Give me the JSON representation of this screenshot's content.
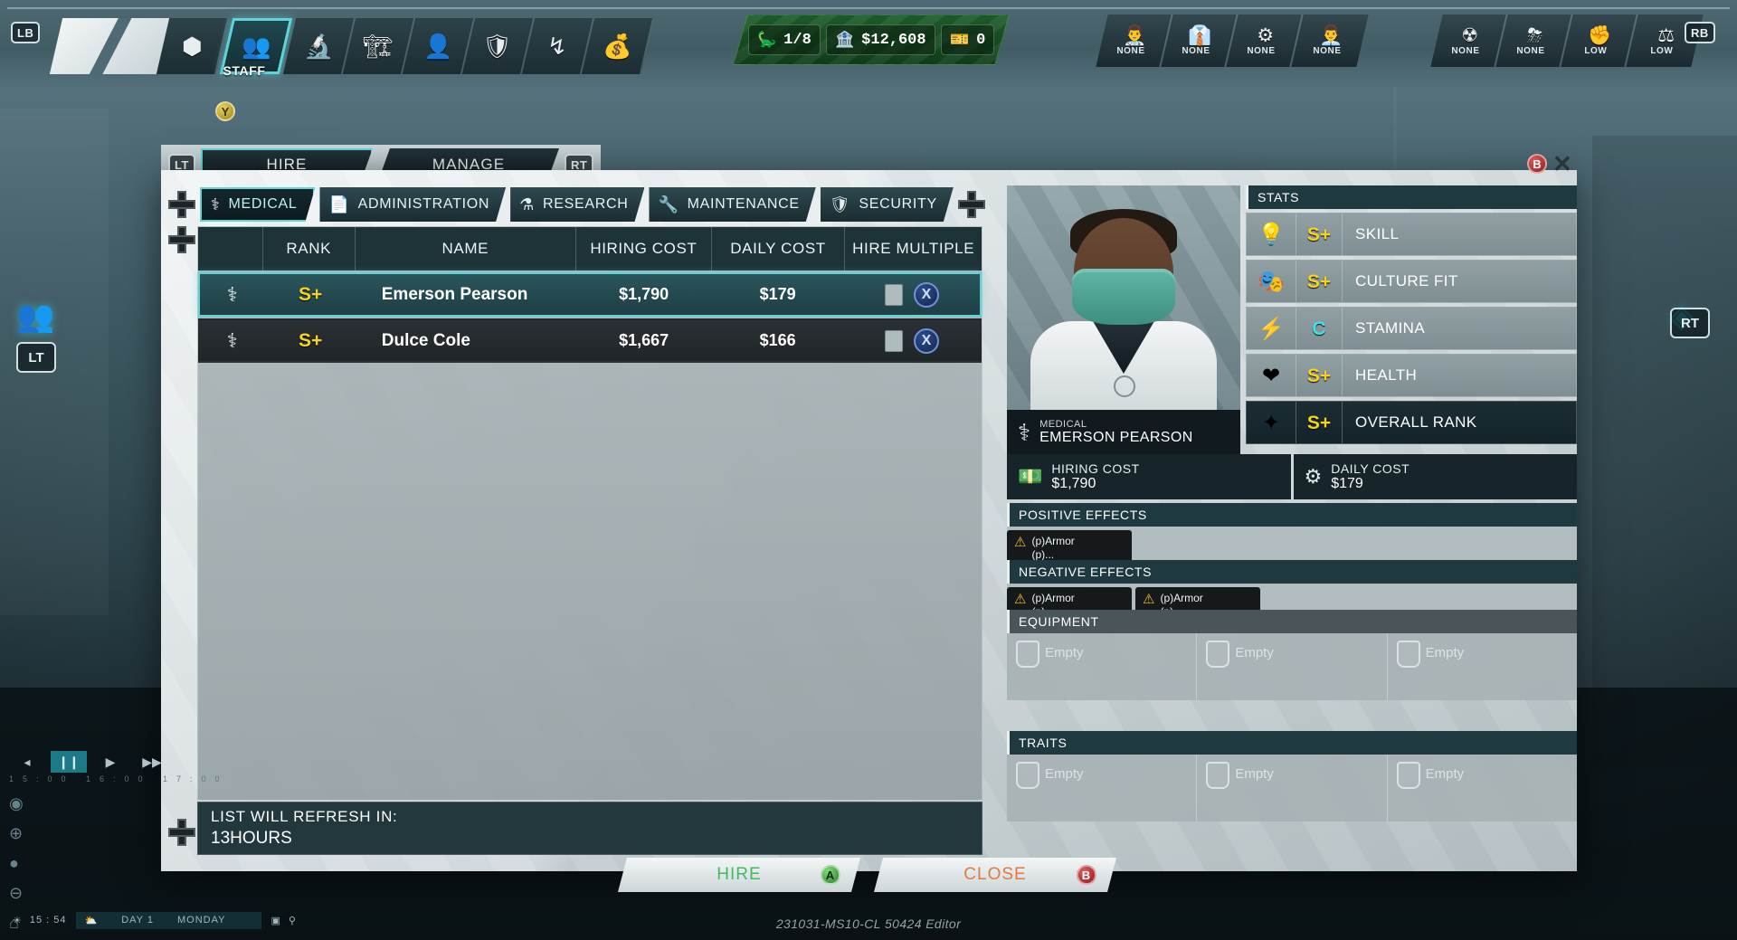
{
  "topbar": {
    "lb_button": "LB",
    "rb_button": "RB",
    "nav_icons": [
      {
        "name": "overview-icon",
        "glyph": "⬢"
      },
      {
        "name": "staff-icon",
        "glyph": "👥"
      },
      {
        "name": "research-icon",
        "glyph": "🔬"
      },
      {
        "name": "construction-icon",
        "glyph": "🏗"
      },
      {
        "name": "visitors-icon",
        "glyph": "👤"
      },
      {
        "name": "security-icon",
        "glyph": "🛡"
      },
      {
        "name": "transport-icon",
        "glyph": "↯"
      },
      {
        "name": "finance-icon",
        "glyph": "💰"
      }
    ],
    "active_tab_label": "STAFF",
    "active_tab_button": "Y",
    "resources": [
      {
        "name": "dinosaur-count",
        "icon": "🦕",
        "value": "1/8"
      },
      {
        "name": "money",
        "icon": "🏦",
        "value": "$12,608"
      },
      {
        "name": "guests",
        "icon": "🎫",
        "value": "0"
      }
    ],
    "staff_cluster": [
      {
        "name": "staff-medical",
        "icon": "👨‍⚕",
        "label": "NONE"
      },
      {
        "name": "staff-admin",
        "icon": "👔",
        "label": "NONE"
      },
      {
        "name": "staff-maintenance",
        "icon": "⚙",
        "label": "NONE"
      },
      {
        "name": "staff-research",
        "icon": "👨‍💼",
        "label": "NONE"
      }
    ],
    "status_cluster": [
      {
        "name": "disease-status",
        "icon": "☢",
        "label": "NONE"
      },
      {
        "name": "weather-status",
        "icon": "⛈",
        "label": "NONE"
      },
      {
        "name": "unrest-status",
        "icon": "✊",
        "label": "LOW"
      },
      {
        "name": "reputation-status",
        "icon": "⚖",
        "label": "LOW"
      }
    ]
  },
  "left_hud": {
    "staff_icon": "👥",
    "lt_button": "LT",
    "rt_button": "RT"
  },
  "modal": {
    "mode_tabs": {
      "lt_button": "LT",
      "rt_button": "RT",
      "items": [
        {
          "label": "HIRE",
          "active": true
        },
        {
          "label": "MANAGE",
          "active": false
        }
      ]
    },
    "close_button": "B",
    "close_icon": "✕",
    "category_tabs": [
      {
        "label": "MEDICAL",
        "icon": "⚕",
        "active": true
      },
      {
        "label": "ADMINISTRATION",
        "icon": "📄",
        "active": false
      },
      {
        "label": "RESEARCH",
        "icon": "⚗",
        "active": false
      },
      {
        "label": "MAINTENANCE",
        "icon": "🔧",
        "active": false
      },
      {
        "label": "SECURITY",
        "icon": "🛡",
        "active": false
      }
    ],
    "table": {
      "headers": [
        "",
        "RANK",
        "NAME",
        "HIRING COST",
        "DAILY COST",
        "HIRE MULTIPLE"
      ],
      "rows": [
        {
          "role_icon": "⚕",
          "rank": "S+",
          "name": "Emerson Pearson",
          "hiring_cost": "$1,790",
          "daily_cost": "$179",
          "multiple_checkbox": false,
          "multiple_button": "X",
          "selected": true
        },
        {
          "role_icon": "⚕",
          "rank": "S+",
          "name": "Dulce Cole",
          "hiring_cost": "$1,667",
          "daily_cost": "$166",
          "multiple_checkbox": false,
          "multiple_button": "X",
          "selected": false
        }
      ]
    },
    "refresh": {
      "label": "LIST WILL REFRESH IN:",
      "value": "13HOURS"
    },
    "detail": {
      "role": "MEDICAL",
      "name": "EMERSON PEARSON",
      "role_icon": "⚕",
      "stats_header": "STATS",
      "stats": [
        {
          "name": "skill",
          "icon": "💡",
          "grade": "S+",
          "label": "SKILL"
        },
        {
          "name": "culture-fit",
          "icon": "🎭",
          "grade": "S+",
          "label": "CULTURE FIT"
        },
        {
          "name": "stamina",
          "icon": "⚡",
          "grade": "C",
          "label": "STAMINA"
        },
        {
          "name": "health",
          "icon": "❤",
          "grade": "S+",
          "label": "HEALTH"
        },
        {
          "name": "overall-rank",
          "icon": "✦",
          "grade": "S+",
          "label": "OVERALL RANK"
        }
      ],
      "costs": [
        {
          "name": "hiring-cost",
          "icon": "💵",
          "label": "HIRING COST",
          "value": "$1,790"
        },
        {
          "name": "daily-cost",
          "icon": "⚙",
          "label": "DAILY COST",
          "value": "$179"
        }
      ],
      "positive_effects": {
        "header": "POSITIVE EFFECTS",
        "items": [
          {
            "icon": "⚠",
            "line1": "(p)Armor",
            "line2": "(p)..."
          }
        ]
      },
      "negative_effects": {
        "header": "NEGATIVE EFFECTS",
        "items": [
          {
            "icon": "⚠",
            "line1": "(p)Armor",
            "line2": "(p)..."
          },
          {
            "icon": "⚠",
            "line1": "(p)Armor",
            "line2": "(p)..."
          }
        ]
      },
      "equipment": {
        "header": "EQUIPMENT",
        "slots": [
          "Empty",
          "Empty",
          "Empty"
        ]
      },
      "traits": {
        "header": "TRAITS",
        "slots": [
          "Empty",
          "Empty",
          "Empty"
        ]
      }
    },
    "footer": [
      {
        "name": "hire-button",
        "label": "HIRE",
        "button": "A"
      },
      {
        "name": "close-button",
        "label": "CLOSE",
        "button": "B"
      }
    ]
  },
  "bottom": {
    "speed_controls": [
      {
        "name": "speed-mute",
        "glyph": "◂"
      },
      {
        "name": "speed-pause",
        "glyph": "❙❙",
        "active": true
      },
      {
        "name": "speed-play",
        "glyph": "▶"
      },
      {
        "name": "speed-fast",
        "glyph": "▶▶"
      }
    ],
    "timeline_ticks": "15:00   16:00   17:00",
    "zoom_controls": [
      {
        "name": "camera-icon",
        "glyph": "◉"
      },
      {
        "name": "zoom-in-icon",
        "glyph": "⊕"
      },
      {
        "name": "ranger-icon",
        "glyph": "●"
      },
      {
        "name": "zoom-out-icon",
        "glyph": "⊖"
      },
      {
        "name": "home-icon",
        "glyph": "⌂"
      }
    ],
    "clock_icon": "☀",
    "clock": "15 : 54",
    "day_icon": "⛅",
    "day": "DAY 1",
    "weekday": "MONDAY",
    "extra_icons": [
      "▣",
      "⚲"
    ],
    "watermark": "231031-MS10-CL 50424 Editor"
  }
}
